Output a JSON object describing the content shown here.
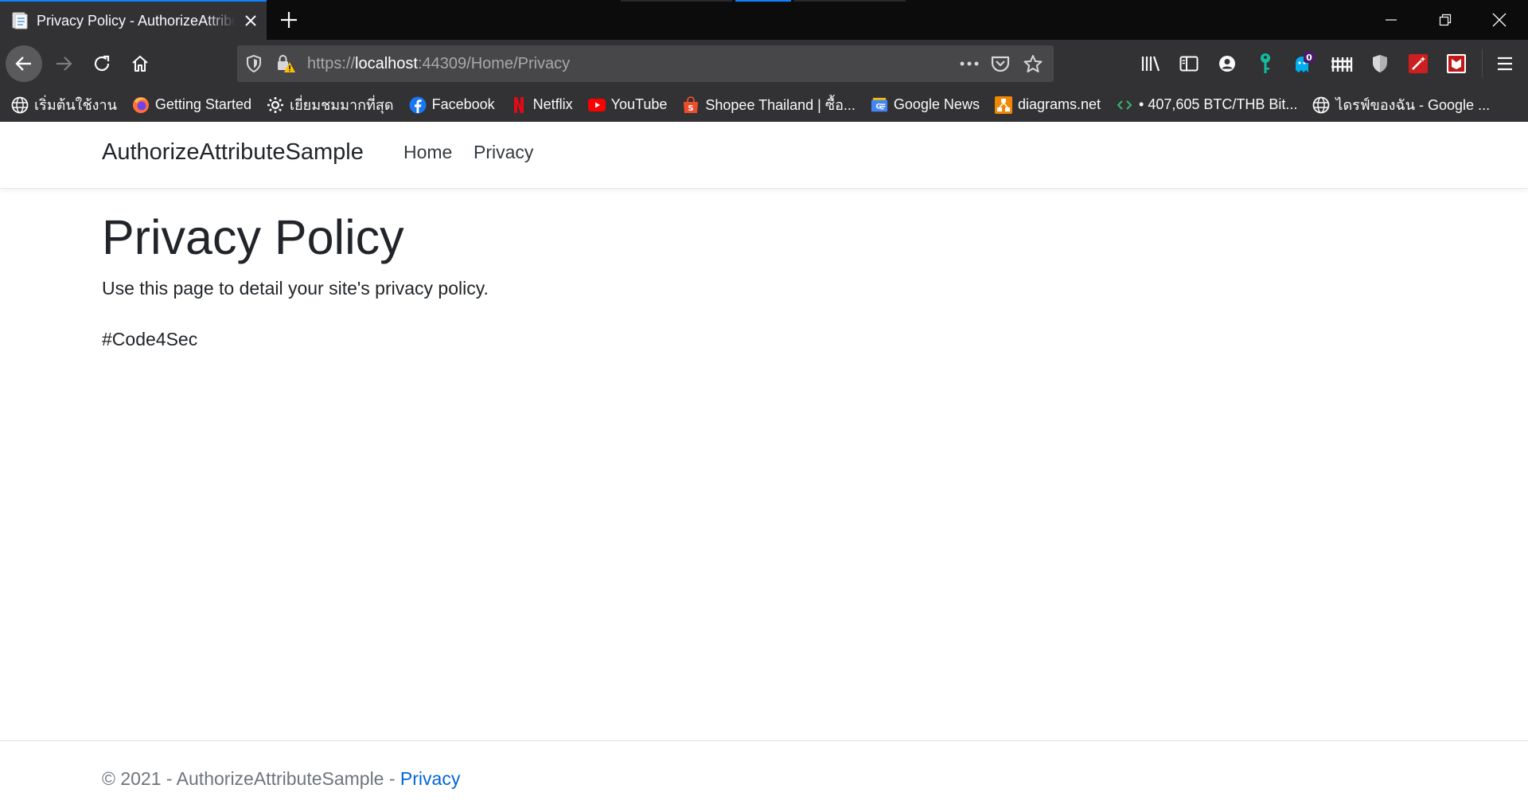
{
  "browser": {
    "tab": {
      "title": "Privacy Policy - AuthorizeAttributeSample"
    },
    "url": {
      "scheme": "https://",
      "host": "localhost",
      "rest": ":44309/Home/Privacy"
    },
    "bookmarks": [
      {
        "label": "เริ่มต้นใช้งาน",
        "icon": "globe-icon"
      },
      {
        "label": "Getting Started",
        "icon": "firefox-icon"
      },
      {
        "label": "เยี่ยมชมมากที่สุด",
        "icon": "gear-icon"
      },
      {
        "label": "Facebook",
        "icon": "facebook-icon"
      },
      {
        "label": "Netflix",
        "icon": "netflix-icon"
      },
      {
        "label": "YouTube",
        "icon": "youtube-icon"
      },
      {
        "label": "Shopee Thailand | ซื้อ...",
        "icon": "shopee-icon"
      },
      {
        "label": "Google News",
        "icon": "google-news-icon"
      },
      {
        "label": "diagrams.net",
        "icon": "diagrams-icon"
      },
      {
        "label": "• 407,605 BTC/THB Bit...",
        "icon": "bitcoin-icon"
      },
      {
        "label": "ไดรฟ์ของฉัน - Google ...",
        "icon": "globe-icon"
      }
    ],
    "extension_badge": "0",
    "colors": {
      "accent": "#0a84ff",
      "chrome": "#323234",
      "tabbar": "#0c0c0d"
    }
  },
  "site": {
    "brand": "AuthorizeAttributeSample",
    "nav": {
      "home": "Home",
      "privacy": "Privacy"
    },
    "main": {
      "title": "Privacy Policy",
      "lead": "Use this page to detail your site's privacy policy.",
      "tag": "#Code4Sec"
    },
    "footer": {
      "text": "© 2021 - AuthorizeAttributeSample - ",
      "link": "Privacy"
    },
    "colors": {
      "link": "#0366d6",
      "muted": "#6c757d",
      "text": "#212529"
    }
  }
}
